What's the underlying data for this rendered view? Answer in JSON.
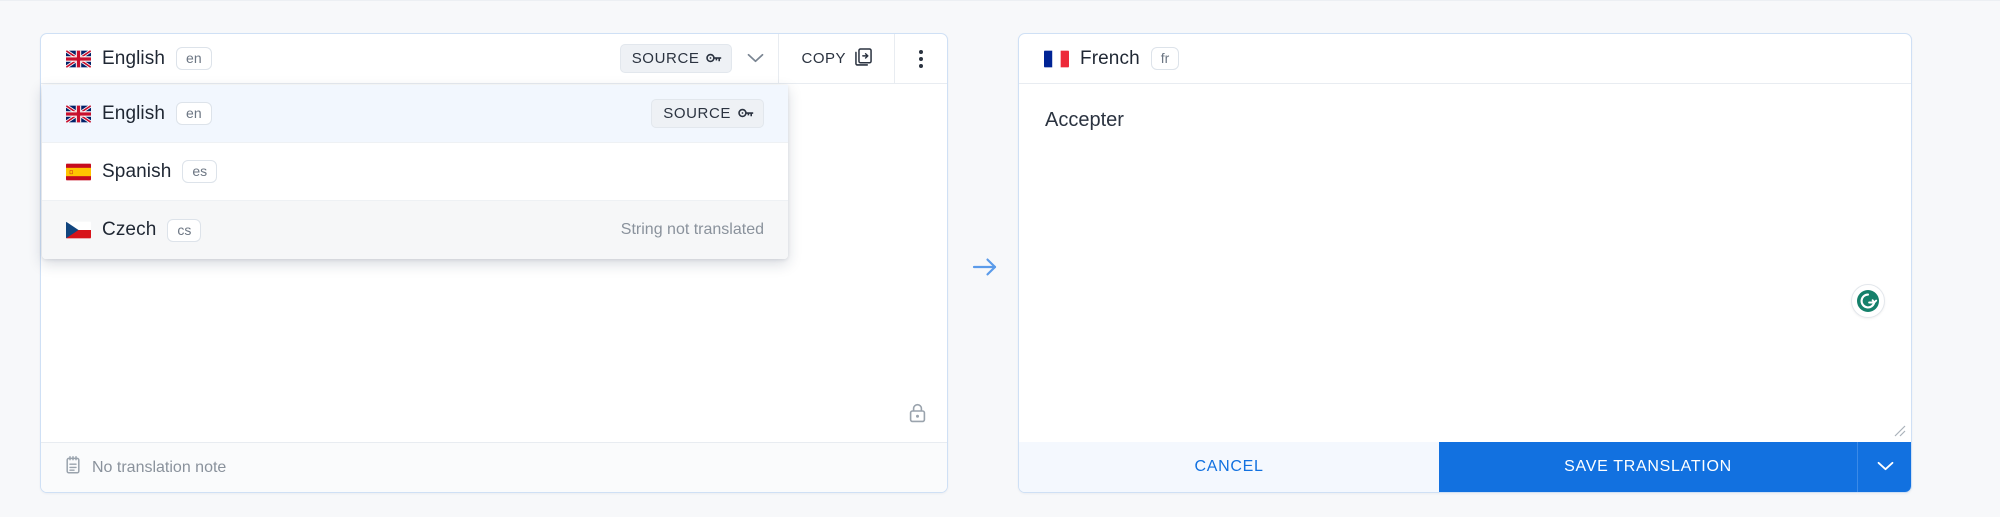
{
  "source": {
    "language": {
      "name": "English",
      "code": "en",
      "flag": "uk-flag-icon"
    },
    "badges": {
      "source_label": "SOURCE"
    },
    "actions": {
      "copy_label": "COPY"
    },
    "note": {
      "text": "No translation note",
      "icon": "note-icon"
    },
    "lock_icon": "lock-icon",
    "dropdown": {
      "items": [
        {
          "name": "English",
          "code": "en",
          "flag": "uk-flag-icon",
          "status": "",
          "badge": "SOURCE",
          "state": "selected"
        },
        {
          "name": "Spanish",
          "code": "es",
          "flag": "spain-flag-icon",
          "status": "",
          "badge": "",
          "state": "normal"
        },
        {
          "name": "Czech",
          "code": "cs",
          "flag": "czech-flag-icon",
          "status": "String not translated",
          "badge": "",
          "state": "hovered"
        }
      ]
    }
  },
  "divider": {
    "arrow_icon": "arrow-right-icon"
  },
  "target": {
    "language": {
      "name": "French",
      "code": "fr",
      "flag": "france-flag-icon"
    },
    "translation_value": "Accepter",
    "translation_placeholder": "",
    "assistant_icon": "grammarly-icon",
    "footer": {
      "cancel_label": "CANCEL",
      "save_label": "SAVE TRANSLATION",
      "caret_icon": "chevron-down-icon"
    }
  },
  "colors": {
    "accent": "#1271e0",
    "panel_border": "#cfe0f5",
    "selected_row": "#f2f7fe",
    "hover_row": "#f6f7f8",
    "muted_text": "#8a929c",
    "grammarly_green": "#15806a"
  }
}
